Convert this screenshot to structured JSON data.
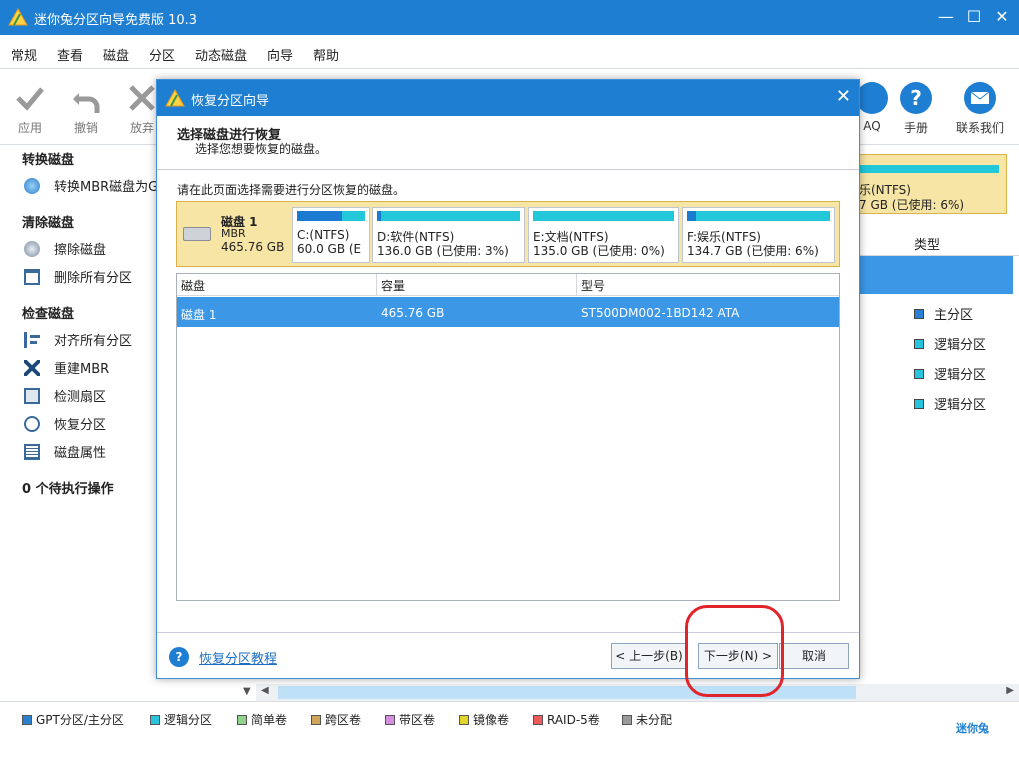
{
  "window": {
    "title": "迷你兔分区向导免费版 10.3"
  },
  "window_controls": {
    "minimize": "—",
    "maximize": "☐",
    "close": "✕"
  },
  "menu": [
    "常规",
    "查看",
    "磁盘",
    "分区",
    "动态磁盘",
    "向导",
    "帮助"
  ],
  "toolbar": {
    "left": [
      {
        "label": "应用",
        "icon": "checkmark-icon"
      },
      {
        "label": "撤销",
        "icon": "undo-icon"
      },
      {
        "label": "放弃",
        "icon": "discard-icon"
      }
    ],
    "right": [
      {
        "label": "AQ",
        "icon": "faq-icon"
      },
      {
        "label": "手册",
        "icon": "help-icon"
      },
      {
        "label": "联系我们",
        "icon": "mail-icon"
      }
    ]
  },
  "sidebar": {
    "sections": [
      {
        "title": "转换磁盘",
        "items": [
          "转换MBR磁盘为GP"
        ]
      },
      {
        "title": "清除磁盘",
        "items": [
          "擦除磁盘",
          "删除所有分区"
        ]
      },
      {
        "title": "检查磁盘",
        "items": [
          "对齐所有分区",
          "重建MBR",
          "检测扇区",
          "恢复分区",
          "磁盘属性"
        ]
      }
    ],
    "pending": "0 个待执行操作"
  },
  "right_pane": {
    "partition_label": "乐(NTFS)",
    "partition_size": "7 GB (已使用: 6%)",
    "type_header": "类型",
    "types": [
      "主分区",
      "逻辑分区",
      "逻辑分区",
      "逻辑分区"
    ]
  },
  "dialog": {
    "title": "恢复分区向导",
    "close": "✕",
    "heading": "选择磁盘进行恢复",
    "subheading": "选择您想要恢复的磁盘。",
    "instruction": "请在此页面选择需要进行分区恢复的磁盘。",
    "disk": {
      "name": "磁盘 1",
      "type": "MBR",
      "size": "465.76 GB"
    },
    "partitions": [
      {
        "label": "C:(NTFS)",
        "size": "60.0 GB (E",
        "used": 0.66
      },
      {
        "label": "D:软件(NTFS)",
        "size": "136.0 GB (已使用: 3%)",
        "used": 0.03
      },
      {
        "label": "E:文档(NTFS)",
        "size": "135.0 GB (已使用: 0%)",
        "used": 0.0
      },
      {
        "label": "F:娱乐(NTFS)",
        "size": "134.7 GB (已使用: 6%)",
        "used": 0.06
      }
    ],
    "table": {
      "headers": [
        "磁盘",
        "容量",
        "型号"
      ],
      "rows": [
        {
          "disk": "磁盘 1",
          "capacity": "465.76 GB",
          "model": "ST500DM002-1BD142 ATA"
        }
      ]
    },
    "help_icon": "?",
    "help_link": "恢复分区教程",
    "buttons": {
      "back": "< 上一步(B)",
      "next": "下一步(N) >",
      "cancel": "取消"
    }
  },
  "legend": [
    {
      "label": "GPT分区/主分区",
      "color": "#2a7fd0"
    },
    {
      "label": "逻辑分区",
      "color": "#27c4db"
    },
    {
      "label": "简单卷",
      "color": "#8fd08a"
    },
    {
      "label": "跨区卷",
      "color": "#d2a65a"
    },
    {
      "label": "带区卷",
      "color": "#d58ee0"
    },
    {
      "label": "镜像卷",
      "color": "#e2d52a"
    },
    {
      "label": "RAID-5卷",
      "color": "#ee5a5a"
    },
    {
      "label": "未分配",
      "color": "#9a9a9a"
    }
  ],
  "brand": "迷你兔"
}
